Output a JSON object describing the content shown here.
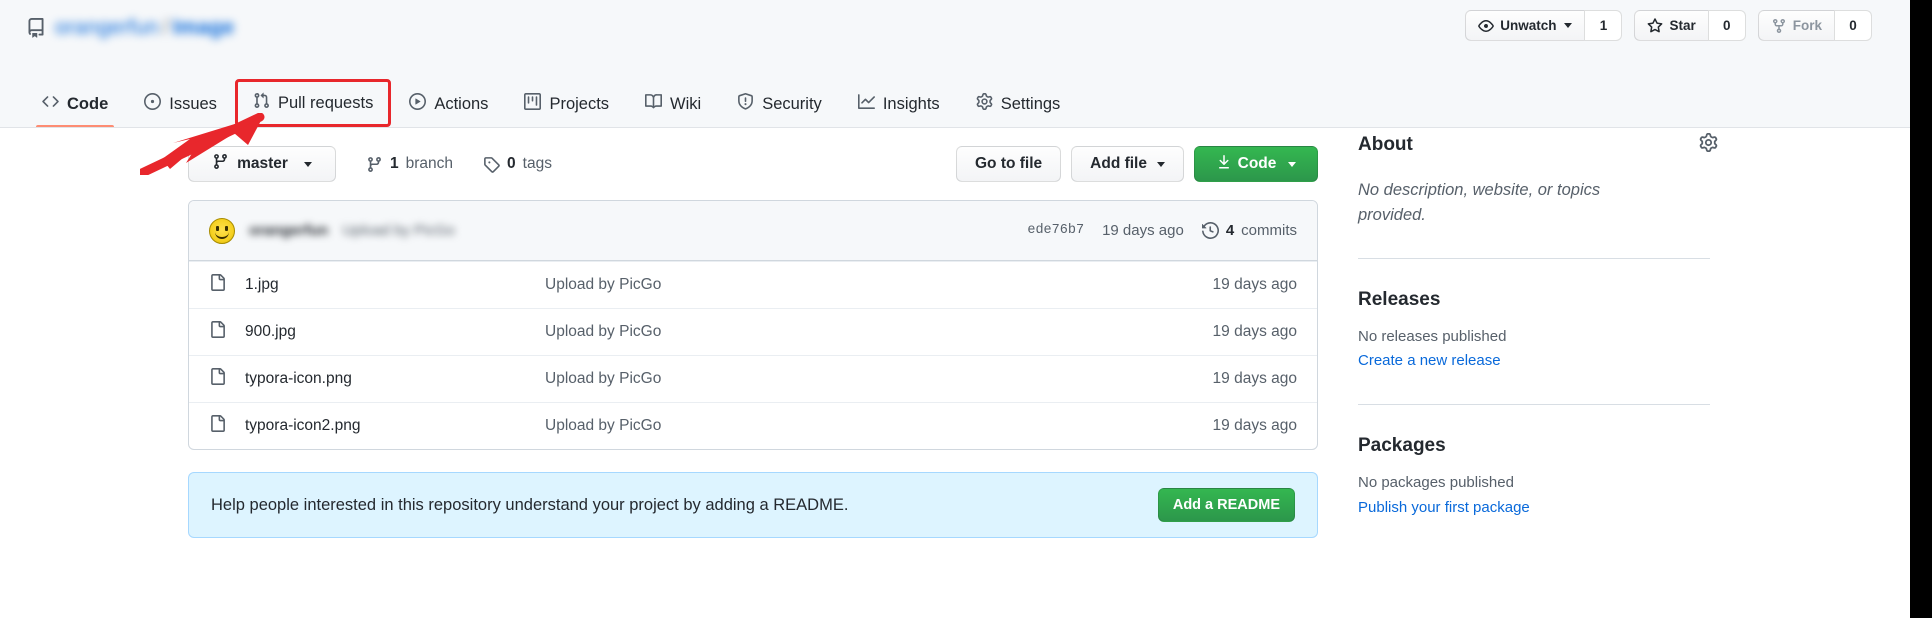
{
  "header": {
    "repo_owner": "orangerfun",
    "repo_separator": "/",
    "repo_name": "Image",
    "repo_icon": "repo-book-icon",
    "watch": {
      "label": "Unwatch",
      "count": "1",
      "icon": "eye-icon"
    },
    "star": {
      "label": "Star",
      "count": "0",
      "icon": "star-icon"
    },
    "fork": {
      "label": "Fork",
      "count": "0",
      "icon": "fork-icon"
    }
  },
  "nav": {
    "items": [
      {
        "label": "Code",
        "icon": "code-icon",
        "selected": true,
        "annotated": false
      },
      {
        "label": "Issues",
        "icon": "issue-icon",
        "selected": false,
        "annotated": false
      },
      {
        "label": "Pull requests",
        "icon": "git-pull-request-icon",
        "selected": false,
        "annotated": true
      },
      {
        "label": "Actions",
        "icon": "play-icon",
        "selected": false,
        "annotated": false
      },
      {
        "label": "Projects",
        "icon": "project-icon",
        "selected": false,
        "annotated": false
      },
      {
        "label": "Wiki",
        "icon": "book-icon",
        "selected": false,
        "annotated": false
      },
      {
        "label": "Security",
        "icon": "shield-icon",
        "selected": false,
        "annotated": false
      },
      {
        "label": "Insights",
        "icon": "graph-icon",
        "selected": false,
        "annotated": false
      },
      {
        "label": "Settings",
        "icon": "gear-icon",
        "selected": false,
        "annotated": false
      }
    ]
  },
  "annotations": {
    "arrow_color": "#e8272c",
    "box_color": "#e8272c",
    "arrow_target": "Pull requests"
  },
  "toolbar": {
    "branch": "master",
    "branch_icon": "branch-icon",
    "branch_count": "1",
    "branch_word": "branch",
    "tags_count": "0",
    "tags_word": "tags",
    "tag_icon": "tag-icon",
    "go_to_file": "Go to file",
    "add_file": "Add file",
    "code": "Code",
    "code_icon": "download-icon"
  },
  "commit_bar": {
    "avatar": "smiley-avatar",
    "author": "orangerfun",
    "message": "Upload by PicGo",
    "sha": "ede76b7",
    "time": "19 days ago",
    "commits_count": "4",
    "commits_label": "commits",
    "history_icon": "history-icon"
  },
  "files": [
    {
      "icon": "file-icon",
      "name": "1.jpg",
      "message": "Upload by PicGo",
      "time": "19 days ago"
    },
    {
      "icon": "file-icon",
      "name": "900.jpg",
      "message": "Upload by PicGo",
      "time": "19 days ago"
    },
    {
      "icon": "file-icon",
      "name": "typora-icon.png",
      "message": "Upload by PicGo",
      "time": "19 days ago"
    },
    {
      "icon": "file-icon",
      "name": "typora-icon2.png",
      "message": "Upload by PicGo",
      "time": "19 days ago"
    }
  ],
  "readme_banner": {
    "text": "Help people interested in this repository understand your project by adding a README.",
    "button": "Add a README"
  },
  "sidebar": {
    "about": {
      "title": "About",
      "gear_icon": "gear-icon",
      "description": "No description, website, or topics provided."
    },
    "releases": {
      "title": "Releases",
      "empty": "No releases published",
      "link": "Create a new release"
    },
    "packages": {
      "title": "Packages",
      "empty": "No packages published",
      "link": "Publish your first package"
    }
  },
  "colors": {
    "accent_green": "#2da44e",
    "link_blue": "#0969da",
    "header_bg": "#f6f8fa",
    "banner_bg": "#ddf4ff",
    "selected_tab": "#fd8c73",
    "annotation_red": "#e8272c"
  }
}
